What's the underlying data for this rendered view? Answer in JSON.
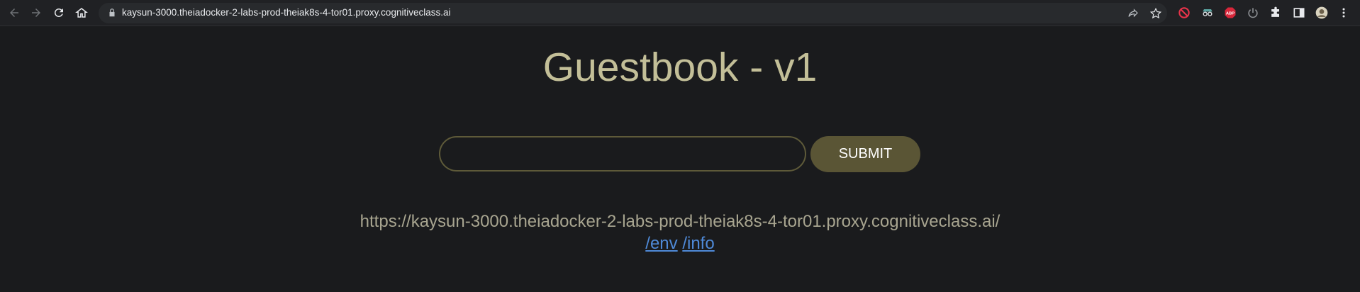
{
  "browser": {
    "url": "kaysun-3000.theiadocker-2-labs-prod-theiak8s-4-tor01.proxy.cognitiveclass.ai",
    "icons": [
      "back-icon",
      "forward-icon",
      "reload-icon",
      "home-icon",
      "lock-icon",
      "share-icon",
      "star-icon",
      "block-extension-icon",
      "spy-extension-icon",
      "adblock-extension-icon",
      "power-extension-icon",
      "extensions-icon",
      "side-panel-icon",
      "profile-avatar",
      "menu-icon"
    ],
    "adblock_badge": "ABP"
  },
  "page": {
    "title": "Guestbook - v1",
    "input_value": "",
    "submit_label": "SUBMIT",
    "base_url": "https://kaysun-3000.theiadocker-2-labs-prod-theiak8s-4-tor01.proxy.cognitiveclass.ai/",
    "links": [
      "/env",
      "/info"
    ]
  },
  "colors": {
    "background": "#1a1b1d",
    "title": "#c3bf98",
    "button": "#5a5535",
    "link": "#4f8ad8"
  }
}
